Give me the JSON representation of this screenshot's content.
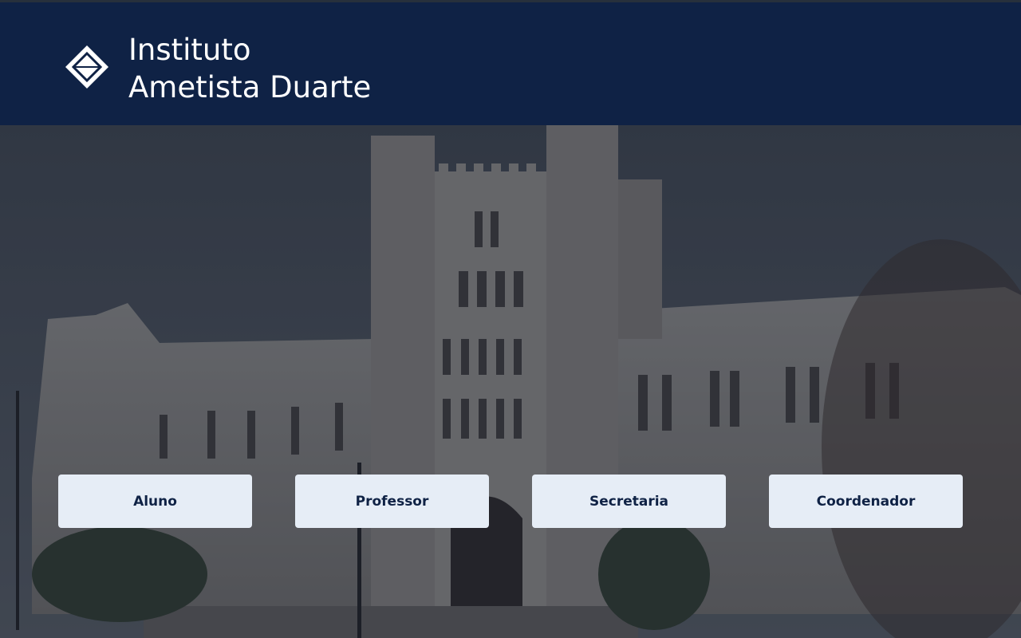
{
  "header": {
    "logo_icon": "diamond-logo-icon",
    "title_line1": "Instituto",
    "title_line2": "Ametista Duarte",
    "background": "#0f2245"
  },
  "hero": {
    "image": "campus-building-photo"
  },
  "roles": [
    {
      "label": "Aluno"
    },
    {
      "label": "Professor"
    },
    {
      "label": "Secretaria"
    },
    {
      "label": "Coordenador"
    }
  ],
  "colors": {
    "primary": "#0f2245",
    "button_bg": "#e6edf6"
  }
}
